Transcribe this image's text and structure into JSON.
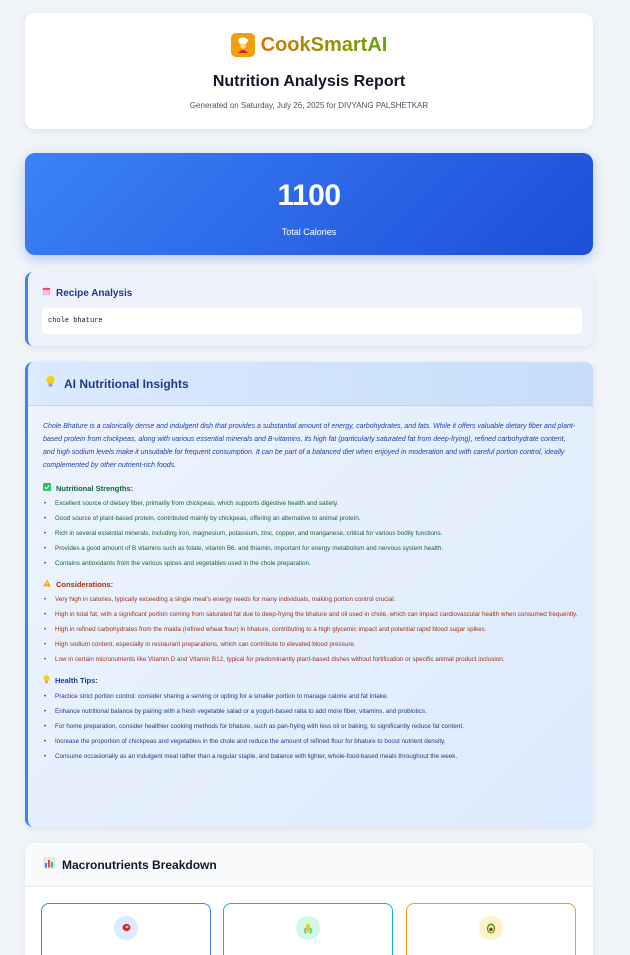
{
  "header": {
    "brand": "CookSmartAI",
    "title": "Nutrition Analysis Report",
    "generated": "Generated on Saturday, July 26, 2025 for DIVYANG PALSHETKAR"
  },
  "calories": {
    "value": "1100",
    "label": "Total Calories"
  },
  "recipe": {
    "title": "Recipe Analysis",
    "text": "chole bhature"
  },
  "insights": {
    "title": "AI Nutritional Insights",
    "summary": "Chole Bhature is a calorically dense and indulgent dish that provides a substantial amount of energy, carbohydrates, and fats. While it offers valuable dietary fiber and plant-based protein from chickpeas, along with various essential minerals and B-vitamins, its high fat (particularly saturated fat from deep-frying), refined carbohydrate content, and high sodium levels make it unsuitable for frequent consumption. It can be part of a balanced diet when enjoyed in moderation and with careful portion control, ideally complemented by other nutrient-rich foods.",
    "strengths": {
      "title": "Nutritional Strengths:",
      "items": [
        "Excellent source of dietary fiber, primarily from chickpeas, which supports digestive health and satiety.",
        "Good source of plant-based protein, contributed mainly by chickpeas, offering an alternative to animal protein.",
        "Rich in several essential minerals, including iron, magnesium, potassium, zinc, copper, and manganese, critical for various bodily functions.",
        "Provides a good amount of B vitamins such as folate, vitamin B6, and thiamin, important for energy metabolism and nervous system health.",
        "Contains antioxidants from the various spices and vegetables used in the chole preparation."
      ]
    },
    "considerations": {
      "title": "Considerations:",
      "items": [
        "Very high in calories, typically exceeding a single meal's energy needs for many individuals, making portion control crucial.",
        "High in total fat, with a significant portion coming from saturated fat due to deep-frying the bhature and oil used in chole, which can impact cardiovascular health when consumed frequently.",
        "High in refined carbohydrates from the maida (refined wheat flour) in bhature, contributing to a high glycemic impact and potential rapid blood sugar spikes.",
        "High sodium content, especially in restaurant preparations, which can contribute to elevated blood pressure.",
        "Low in certain micronutrients like Vitamin D and Vitamin B12, typical for predominantly plant-based dishes without fortification or specific animal product inclusion."
      ]
    },
    "tips": {
      "title": "Health Tips:",
      "items": [
        "Practice strict portion control: consider sharing a serving or opting for a smaller portion to manage calorie and fat intake.",
        "Enhance nutritional balance by pairing with a fresh vegetable salad or a yogurt-based raita to add more fiber, vitamins, and probiotics.",
        "For home preparation, consider healthier cooking methods for bhature, such as pan-frying with less oil or baking, to significantly reduce fat content.",
        "Increase the proportion of chickpeas and vegetables in the chole and reduce the amount of refined flour for bhature to boost nutrient density.",
        "Consume occasionally as an indulgent meal rather than a regular staple, and balance with lighter, whole-food-based meals throughout the week."
      ]
    }
  },
  "macros": {
    "title": "Macronutrients Breakdown",
    "cards": [
      {
        "icon": "meat-icon"
      },
      {
        "icon": "grain-icon"
      },
      {
        "icon": "avocado-icon"
      }
    ]
  },
  "colors": {
    "accent": "#3b82f6",
    "strength": "#166534",
    "consideration": "#9a3412",
    "tip": "#1e3a8a"
  }
}
